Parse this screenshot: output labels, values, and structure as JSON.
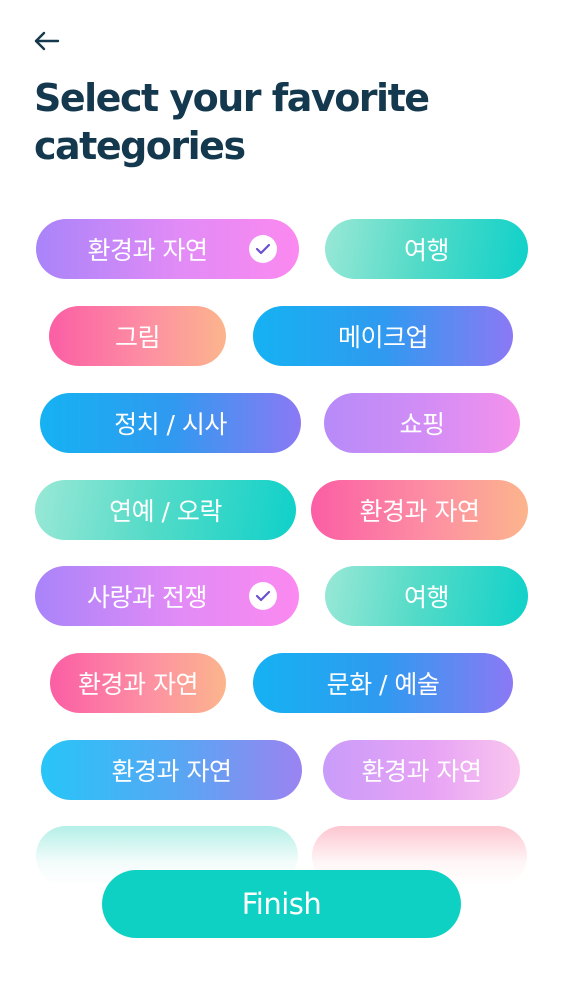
{
  "header": {
    "back_icon": "arrow-left-icon",
    "title_line1": "Select your favorite",
    "title_line2": "categories",
    "title_color": "#14384e"
  },
  "categories": [
    {
      "label": "환경과 자연",
      "selected": true
    },
    {
      "label": "여행",
      "selected": false
    },
    {
      "label": "그림",
      "selected": false
    },
    {
      "label": "메이크업",
      "selected": false
    },
    {
      "label": "정치 / 시사",
      "selected": false
    },
    {
      "label": "쇼핑",
      "selected": false
    },
    {
      "label": "연예 / 오락",
      "selected": false
    },
    {
      "label": "환경과 자연",
      "selected": false
    },
    {
      "label": "사랑과 전쟁",
      "selected": true
    },
    {
      "label": "여행",
      "selected": false
    },
    {
      "label": "환경과 자연",
      "selected": false
    },
    {
      "label": "문화 / 예술",
      "selected": false
    },
    {
      "label": "환경과 자연",
      "selected": false
    },
    {
      "label": "환경과 자연",
      "selected": false
    }
  ],
  "check_icon": "check-icon",
  "footer": {
    "finish_label": "Finish",
    "finish_color": "#0fd1c3"
  }
}
